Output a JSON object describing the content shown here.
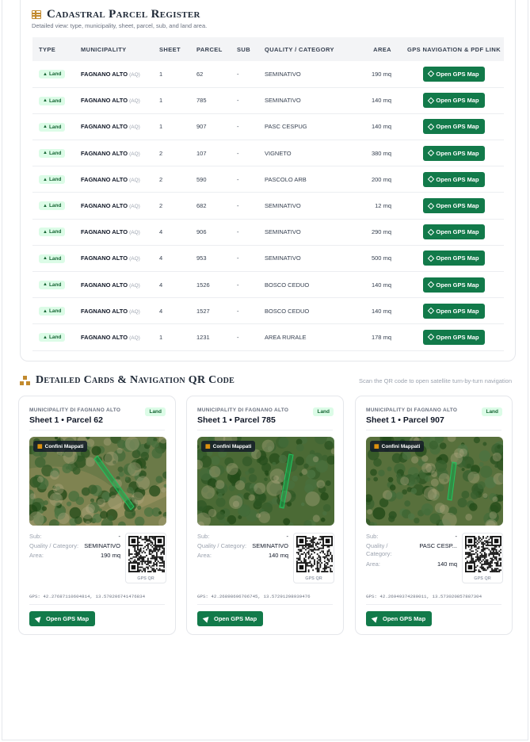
{
  "register": {
    "title": "Cadastral Parcel Register",
    "subtitle": "Detailed view: type, municipality, sheet, parcel, sub, and land area.",
    "headers": {
      "type": "TYPE",
      "municipality": "MUNICIPALITY",
      "sheet": "SHEET",
      "parcel": "PARCEL",
      "sub": "SUB",
      "quality": "QUALITY / CATEGORY",
      "area": "AREA",
      "gps": "GPS NAVIGATION & PDF LINK"
    },
    "badge_label": "Land",
    "button_label": "Open GPS Map",
    "rows": [
      {
        "municipality": "FAGNANO ALTO",
        "prov": "(AQ)",
        "sheet": "1",
        "parcel": "62",
        "sub": "-",
        "quality": "SEMINATIVO",
        "area": "190 mq"
      },
      {
        "municipality": "FAGNANO ALTO",
        "prov": "(AQ)",
        "sheet": "1",
        "parcel": "785",
        "sub": "-",
        "quality": "SEMINATIVO",
        "area": "140 mq"
      },
      {
        "municipality": "FAGNANO ALTO",
        "prov": "(AQ)",
        "sheet": "1",
        "parcel": "907",
        "sub": "-",
        "quality": "PASC CESPUG",
        "area": "140 mq"
      },
      {
        "municipality": "FAGNANO ALTO",
        "prov": "(AQ)",
        "sheet": "2",
        "parcel": "107",
        "sub": "-",
        "quality": "VIGNETO",
        "area": "380 mq"
      },
      {
        "municipality": "FAGNANO ALTO",
        "prov": "(AQ)",
        "sheet": "2",
        "parcel": "590",
        "sub": "-",
        "quality": "PASCOLO ARB",
        "area": "200 mq"
      },
      {
        "municipality": "FAGNANO ALTO",
        "prov": "(AQ)",
        "sheet": "2",
        "parcel": "682",
        "sub": "-",
        "quality": "SEMINATIVO",
        "area": "12 mq"
      },
      {
        "municipality": "FAGNANO ALTO",
        "prov": "(AQ)",
        "sheet": "4",
        "parcel": "906",
        "sub": "-",
        "quality": "SEMINATIVO",
        "area": "290 mq"
      },
      {
        "municipality": "FAGNANO ALTO",
        "prov": "(AQ)",
        "sheet": "4",
        "parcel": "953",
        "sub": "-",
        "quality": "SEMINATIVO",
        "area": "500 mq"
      },
      {
        "municipality": "FAGNANO ALTO",
        "prov": "(AQ)",
        "sheet": "4",
        "parcel": "1526",
        "sub": "-",
        "quality": "BOSCO CEDUO",
        "area": "140 mq"
      },
      {
        "municipality": "FAGNANO ALTO",
        "prov": "(AQ)",
        "sheet": "4",
        "parcel": "1527",
        "sub": "-",
        "quality": "BOSCO CEDUO",
        "area": "140 mq"
      },
      {
        "municipality": "FAGNANO ALTO",
        "prov": "(AQ)",
        "sheet": "1",
        "parcel": "1231",
        "sub": "-",
        "quality": "AREA RURALE",
        "area": "178 mq"
      }
    ]
  },
  "cards_section": {
    "title": "Detailed Cards & Navigation QR Code",
    "note": "Scan the QR code to open satellite turn-by-turn navigation",
    "map_tag": "Confini Mappati",
    "qr_label": "GPS QR",
    "labels": {
      "sub": "Sub:",
      "quality": "Quality / Category:",
      "area": "Area:"
    },
    "button_label": "Open GPS Map",
    "cards": [
      {
        "municipality": "MUNICIPALITY DI FAGNANO ALTO",
        "title": "Sheet 1 • Parcel 62",
        "badge": "Land",
        "sub": "-",
        "quality": "SEMINATIVO",
        "area": "190 mq",
        "gps": "GPS: 42.27687110604814, 13.570206741476834"
      },
      {
        "municipality": "MUNICIPALITY DI FAGNANO ALTO",
        "title": "Sheet 1 • Parcel 785",
        "badge": "Land",
        "sub": "-",
        "quality": "SEMINATIVO",
        "area": "140 mq",
        "gps": "GPS: 42.26898696706745, 13.57291298939476"
      },
      {
        "municipality": "MUNICIPALITY DI FAGNANO ALTO",
        "title": "Sheet 1 • Parcel 907",
        "badge": "Land",
        "sub": "-",
        "quality": "PASC CESP...",
        "area": "140 mq",
        "gps": "GPS: 42.26949374280011, 13.573020857887304"
      }
    ]
  },
  "colors": {
    "accent": "#127a4a",
    "badge_bg": "#dcfce7",
    "badge_text": "#166534",
    "gold": "#c28a2e"
  }
}
